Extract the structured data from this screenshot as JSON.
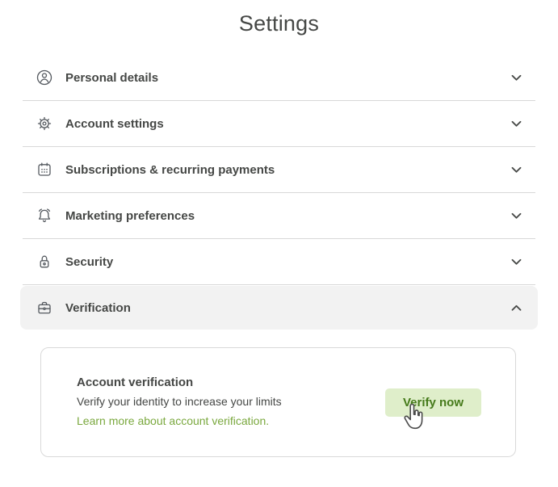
{
  "page": {
    "title": "Settings"
  },
  "accordion": {
    "items": [
      {
        "label": "Personal details",
        "icon": "person-icon",
        "state": "collapsed"
      },
      {
        "label": "Account settings",
        "icon": "gear-icon",
        "state": "collapsed"
      },
      {
        "label": "Subscriptions & recurring payments",
        "icon": "calendar-icon",
        "state": "collapsed"
      },
      {
        "label": "Marketing preferences",
        "icon": "bell-icon",
        "state": "collapsed"
      },
      {
        "label": "Security",
        "icon": "lock-icon",
        "state": "collapsed"
      },
      {
        "label": "Verification",
        "icon": "briefcase-icon",
        "state": "expanded"
      }
    ]
  },
  "verification_panel": {
    "heading": "Account verification",
    "description": "Verify your identity to increase your limits",
    "link_text": "Learn more about account verification.",
    "button_label": "Verify now"
  },
  "colors": {
    "accent_green_light": "#dfeeca",
    "accent_green_text": "#457a1a",
    "link_green": "#7aa83e",
    "row_highlight": "#f2f2f2",
    "divider": "#d8d8d8",
    "text": "#454745"
  }
}
